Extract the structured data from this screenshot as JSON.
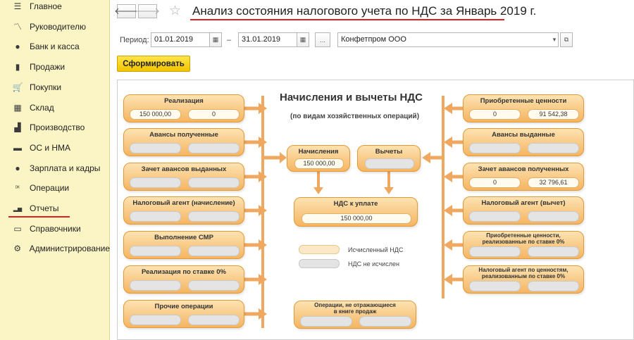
{
  "sidebar": {
    "items": [
      {
        "label": "Главное",
        "icon": "menu-icon"
      },
      {
        "label": "Руководителю",
        "icon": "trend-icon"
      },
      {
        "label": "Банк и касса",
        "icon": "coin-icon"
      },
      {
        "label": "Продажи",
        "icon": "bag-icon"
      },
      {
        "label": "Покупки",
        "icon": "cart-icon"
      },
      {
        "label": "Склад",
        "icon": "grid-icon"
      },
      {
        "label": "Производство",
        "icon": "factory-icon"
      },
      {
        "label": "ОС и НМА",
        "icon": "truck-icon"
      },
      {
        "label": "Зарплата и кадры",
        "icon": "person-icon"
      },
      {
        "label": "Операции",
        "icon": "operations-icon"
      },
      {
        "label": "Отчеты",
        "icon": "bar-chart-icon"
      },
      {
        "label": "Справочники",
        "icon": "book-icon"
      },
      {
        "label": "Администрирование",
        "icon": "gear-icon"
      }
    ],
    "selected": "Отчеты"
  },
  "header": {
    "title": "Анализ состояния налогового учета по НДС за Январь 2019 г.",
    "back_icon": "arrow-left-icon",
    "forward_icon": "arrow-right-icon",
    "favorite_icon": "star-icon"
  },
  "params": {
    "period_label": "Период:",
    "date_from": "01.01.2019",
    "dash": "–",
    "date_to": "31.01.2019",
    "ellipsis": "...",
    "organization": "Конфетпром ООО",
    "run_button": "Сформировать"
  },
  "report": {
    "title": "Начисления и вычеты НДС",
    "subtitle": "(по видам хозяйственных операций)",
    "left_boxes": [
      {
        "title": "Реализация",
        "v1": "150 000,00",
        "v2": "0"
      },
      {
        "title": "Авансы полученные",
        "v1": "",
        "v2": ""
      },
      {
        "title": "Зачет авансов выданных",
        "v1": "",
        "v2": ""
      },
      {
        "title": "Налоговый агент (начисление)",
        "v1": "",
        "v2": ""
      },
      {
        "title": "Выполнение СМР",
        "v1": "",
        "v2": ""
      },
      {
        "title": "Реализация по ставке 0%",
        "v1": "",
        "v2": ""
      },
      {
        "title": "Прочие операции",
        "v1": "",
        "v2": ""
      }
    ],
    "right_boxes": [
      {
        "title": "Приобретенные ценности",
        "title2": "",
        "v1": "0",
        "v2": "91 542,38"
      },
      {
        "title": "Авансы выданные",
        "title2": "",
        "v1": "",
        "v2": ""
      },
      {
        "title": "Зачет авансов полученных",
        "title2": "",
        "v1": "0",
        "v2": "32 796,61"
      },
      {
        "title": "Налоговый агент (вычет)",
        "title2": "",
        "v1": "",
        "v2": ""
      },
      {
        "title": "Приобретенные ценности,",
        "title2": "реализованные по ставке 0%",
        "v1": "",
        "v2": ""
      },
      {
        "title": "Налоговый агент по ценностям,",
        "title2": "реализованным по ставке 0%",
        "v1": "",
        "v2": ""
      }
    ],
    "accruals": {
      "title": "Начисления",
      "value": "150 000,00"
    },
    "deductions": {
      "title": "Вычеты",
      "value": ""
    },
    "payable": {
      "title": "НДС к уплате",
      "value": "150 000,00"
    },
    "legend": [
      {
        "label": "Исчисленный НДС",
        "color": "#fbe8c6"
      },
      {
        "label": "НДС не исчислен",
        "color": "#e4e4e4"
      }
    ],
    "not_in_book": {
      "title": "Операции, не отражающиеся",
      "title2": "в книге продаж",
      "v1": "",
      "v2": ""
    }
  },
  "colors": {
    "sidebar_bg": "#fbf4c4",
    "box_fill": "#f5b561",
    "box_border": "#e39a35",
    "arrow": "#f0a860",
    "run_button": "#f2c300",
    "highlight_underline": "#e02020"
  }
}
